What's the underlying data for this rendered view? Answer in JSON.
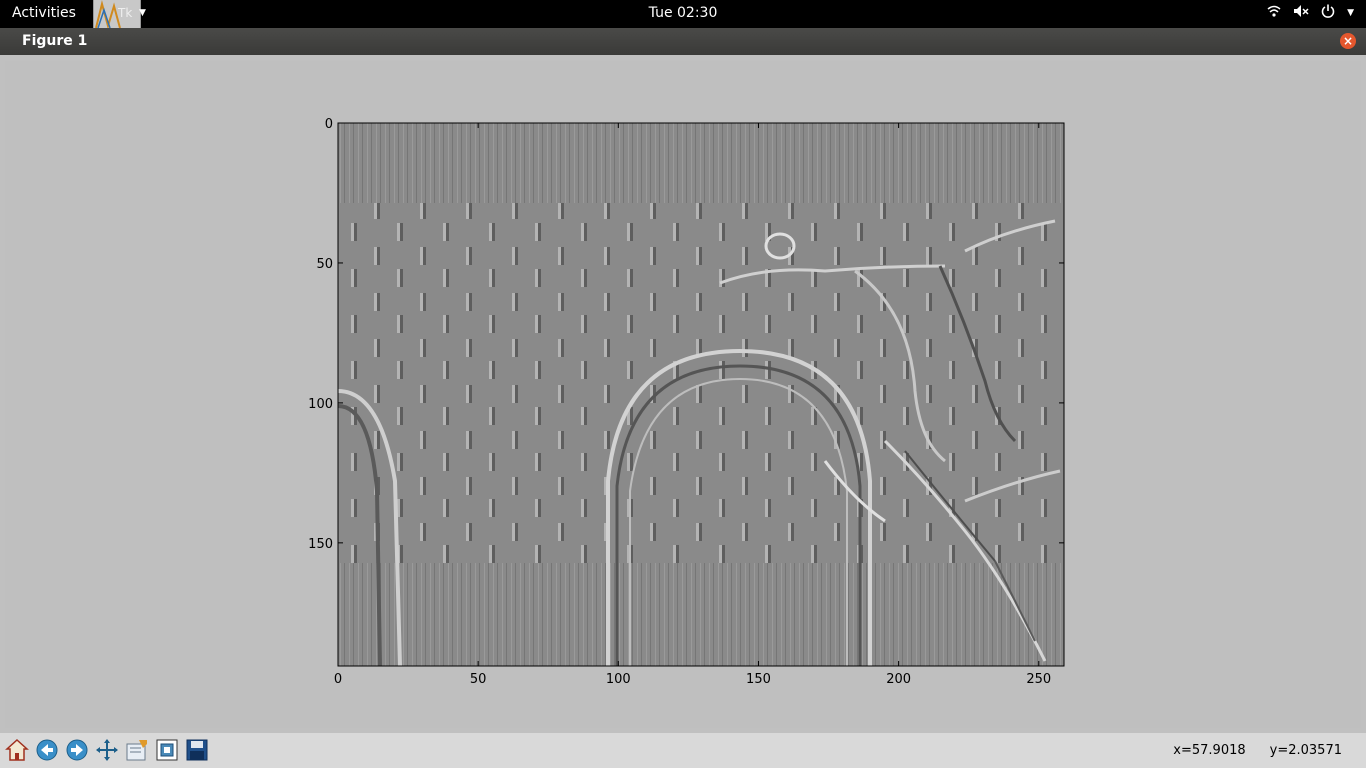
{
  "topbar": {
    "activities_label": "Activities",
    "app_label": "Tk",
    "clock": "Tue 02:30",
    "tray_icons": [
      "wifi-icon",
      "volume-muted-icon",
      "power-icon"
    ]
  },
  "window": {
    "title": "Figure 1"
  },
  "plot": {
    "type": "image",
    "x_ticks": [
      "0",
      "50",
      "100",
      "150",
      "200",
      "250"
    ],
    "y_ticks": [
      "0",
      "50",
      "100",
      "150"
    ],
    "xlim": [
      0,
      259
    ],
    "ylim": [
      194,
      0
    ],
    "description_colormap": "gray"
  },
  "toolbar": {
    "buttons": [
      "home-icon",
      "back-icon",
      "forward-icon",
      "pan-icon",
      "configure-subplots-icon",
      "zoom-icon",
      "save-icon"
    ],
    "coord_x": "x=57.9018",
    "coord_y": "y=2.03571"
  }
}
